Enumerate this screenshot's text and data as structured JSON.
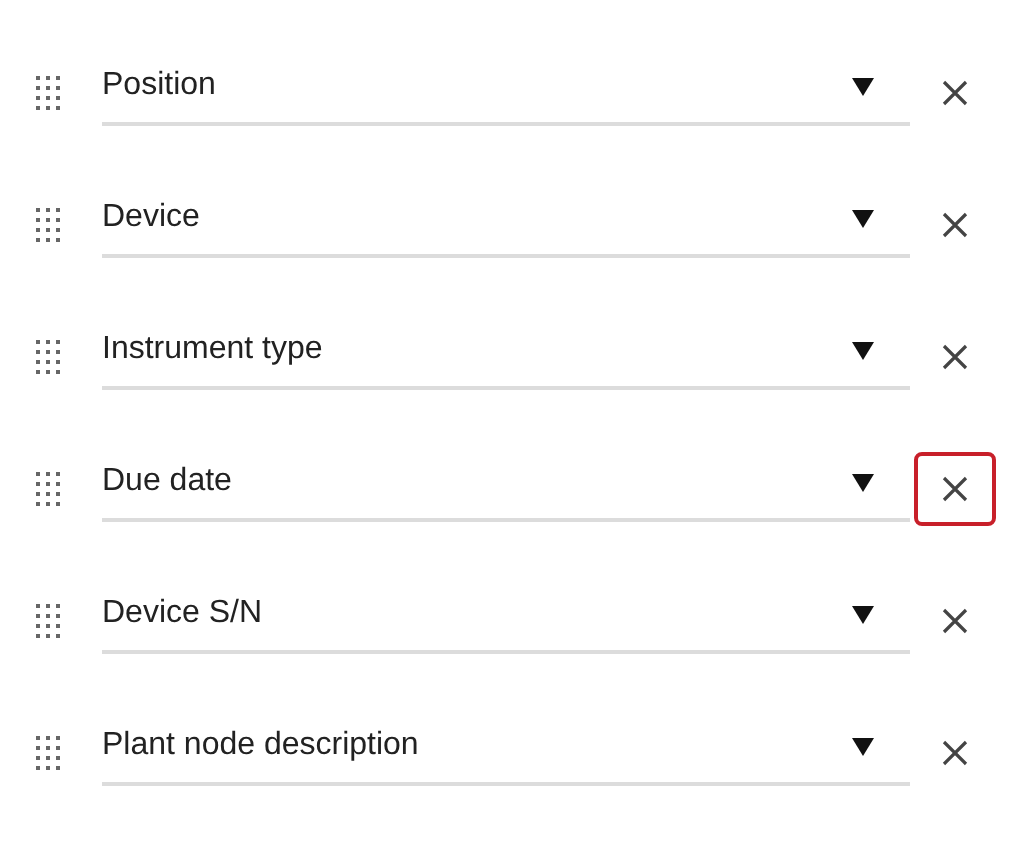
{
  "fields": [
    {
      "label": "Position",
      "remove_focused": false
    },
    {
      "label": "Device",
      "remove_focused": false
    },
    {
      "label": "Instrument type",
      "remove_focused": false
    },
    {
      "label": "Due date",
      "remove_focused": true
    },
    {
      "label": "Device S/N",
      "remove_focused": false
    },
    {
      "label": "Plant node description",
      "remove_focused": false
    }
  ]
}
